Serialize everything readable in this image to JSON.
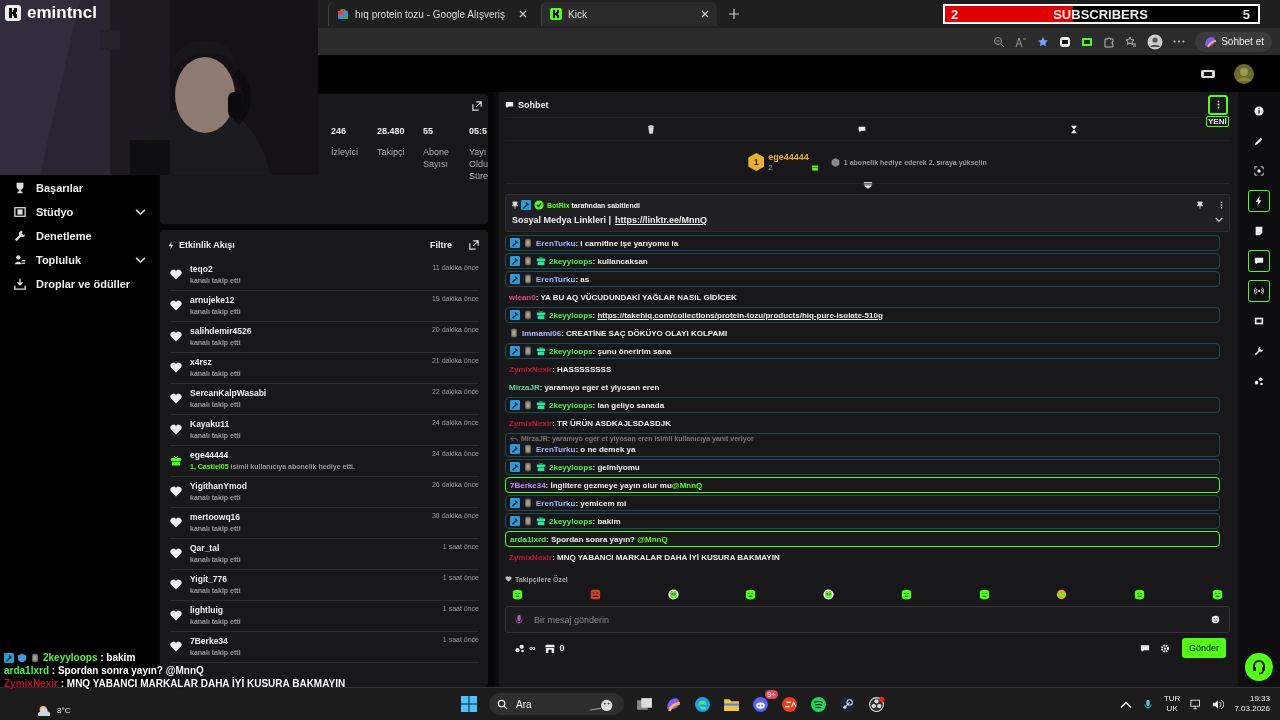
{
  "overlay": {
    "channel": "emintncl",
    "subscribers": {
      "current": "2",
      "label": "SUBSCRIBERS",
      "goal": "5",
      "level": 0.41
    },
    "chat_lines": [
      {
        "user": "2keyyloops",
        "color": "#4ff04f",
        "text": ": bakim",
        "badges": true
      },
      {
        "user": "arda1lxrd",
        "color": "#4ff04f",
        "text": ": Spordan sonra yayın? @MnnQ",
        "badges": false
      },
      {
        "user": "ZymixNexir",
        "color": "#c0143c",
        "text": ": MNQ YABANCI MARKALAR DAHA İYİ KUSURA BAKMAYIN",
        "badges": false
      }
    ]
  },
  "browser": {
    "tabs": [
      {
        "title": "hıq protein tozu - Google Alışveriş",
        "kind": "google",
        "selected": false
      },
      {
        "title": "Kick",
        "kind": "kick",
        "selected": true
      }
    ],
    "copilot_button": "Sohbet et"
  },
  "sidebar": {
    "items": [
      {
        "label": "Başarılar",
        "expandable": false
      },
      {
        "label": "Stüdyo",
        "expandable": true
      },
      {
        "label": "Denetleme",
        "expandable": false
      },
      {
        "label": "Topluluk",
        "expandable": true
      },
      {
        "label": "Droplar ve ödüller",
        "expandable": false
      }
    ]
  },
  "stats": [
    {
      "value": "246",
      "label": "İzleyici"
    },
    {
      "value": "28.480",
      "label": "Takipçi"
    },
    {
      "value": "55",
      "label": "Abone Sayısı"
    },
    {
      "value": "05:5",
      "label": "Yayı Oldu Süre"
    }
  ],
  "activity": {
    "title": "Etkinlik Akışı",
    "filter": "Filtre",
    "items": [
      {
        "kind": "follow",
        "name": "teqo2",
        "detail": "kanalı takip etti",
        "time": "11 dakika önce"
      },
      {
        "kind": "follow",
        "name": "arnujeke12",
        "detail": "kanalı takip etti",
        "time": "19 dakika önce"
      },
      {
        "kind": "follow",
        "name": "salihdemir4526",
        "detail": "kanalı takip etti",
        "time": "20 dakika önce"
      },
      {
        "kind": "follow",
        "name": "x4rsz",
        "detail": "kanalı takip etti",
        "time": "21 dakika önce"
      },
      {
        "kind": "follow",
        "name": "SercanKalpWasabi",
        "detail": "kanalı takip etti",
        "time": "22 dakika önce"
      },
      {
        "kind": "follow",
        "name": "Kayaku11",
        "detail": "kanalı takip etti",
        "time": "24 dakika önce"
      },
      {
        "kind": "gift",
        "name": "ege44444",
        "recipient": "1, Castiel05",
        "detail": "isimli kullanıcıya abonelik hediye etti.",
        "time": "24 dakika önce"
      },
      {
        "kind": "follow",
        "name": "YigithanYmod",
        "detail": "kanalı takip etti",
        "time": "26 dakika önce"
      },
      {
        "kind": "follow",
        "name": "mertoowq16",
        "detail": "kanalı takip etti",
        "time": "38 dakika önce"
      },
      {
        "kind": "follow",
        "name": "Qar_tal",
        "detail": "kanalı takip etti",
        "time": "1 saat önce"
      },
      {
        "kind": "follow",
        "name": "Yigit_776",
        "detail": "kanalı takip etti",
        "time": "1 saat önce"
      },
      {
        "kind": "follow",
        "name": "lightluig",
        "detail": "kanalı takip etti",
        "time": "1 saat önce"
      },
      {
        "kind": "follow",
        "name": "7Berke34",
        "detail": "kanalı takip etti",
        "time": "1 saat önce"
      }
    ]
  },
  "chat": {
    "title": "Sohbet",
    "new_label": "YENİ",
    "leader": {
      "rank": "1",
      "user": "ege44444",
      "count": "2",
      "hint": "1 abonelik hediye ederek 2. sıraya yükselin"
    },
    "pinned": {
      "bot": "BotRix",
      "by": "tarafından sabitlendi",
      "text": "Sosyal Medya Linkleri |",
      "link": "https://linktr.ee/MnnQ"
    },
    "messages": [
      {
        "kind": "boxed",
        "user": "ErenTurku",
        "color": "#9fb4ff",
        "moderator": true,
        "subscriber": true,
        "gifter": false,
        "text": ": I carnitine işe yarıyomu la"
      },
      {
        "kind": "boxed",
        "user": "2keyyloops",
        "color": "#4ff04f",
        "moderator": true,
        "subscriber": true,
        "gifter": true,
        "text": ": kullancaksan"
      },
      {
        "kind": "boxed",
        "user": "ErenTurku",
        "color": "#9fb4ff",
        "moderator": true,
        "subscriber": true,
        "gifter": false,
        "text": ": as"
      },
      {
        "kind": "plain",
        "user": "wlean0",
        "color": "#e0457b",
        "moderator": false,
        "subscriber": false,
        "gifter": false,
        "text": ": YA BU AQ VÜCUDUNDAKİ YAĞLAR NASIL GİDİCEK"
      },
      {
        "kind": "boxed",
        "user": "2keyyloops",
        "color": "#4ff04f",
        "moderator": true,
        "subscriber": true,
        "gifter": true,
        "text": ":",
        "link": "https://takehiq.com/collections/protein-tozu/products/hiq-pure-isolate-510g"
      },
      {
        "kind": "plain",
        "user": "Immami06",
        "color": "#b7b7ff",
        "moderator": false,
        "subscriber": true,
        "gifter": false,
        "text": ": CREATİNE SAÇ DÖKÜYO OLAYI KOLPAMI"
      },
      {
        "kind": "boxed",
        "user": "2keyyloops",
        "color": "#4ff04f",
        "moderator": true,
        "subscriber": true,
        "gifter": true,
        "text": ": şunu öneririm sana"
      },
      {
        "kind": "plain",
        "user": "ZymixNexir",
        "color": "#c0143c",
        "moderator": false,
        "subscriber": false,
        "gifter": false,
        "text": ": HASSSSSSSS"
      },
      {
        "kind": "plain",
        "user": "MirzaJR",
        "color": "#5fd6a6",
        "moderator": false,
        "subscriber": false,
        "gifter": false,
        "text": ": yaramıyo eger et yiyosan eren"
      },
      {
        "kind": "boxed",
        "user": "2keyyloops",
        "color": "#4ff04f",
        "moderator": true,
        "subscriber": true,
        "gifter": true,
        "text": ": lan geliyo sanada"
      },
      {
        "kind": "plain",
        "user": "ZymixNexir",
        "color": "#c0143c",
        "moderator": false,
        "subscriber": false,
        "gifter": false,
        "text": ": TR ÜRÜN ASDKAJLSDASDJK"
      },
      {
        "kind": "boxed",
        "reply": "MirzaJR: yaramıyo eger et yiyosan eren isimli kullanıcıya yanıt veriyor",
        "user": "ErenTurku",
        "color": "#9fb4ff",
        "moderator": true,
        "subscriber": true,
        "gifter": false,
        "text": ": o ne demek ya"
      },
      {
        "kind": "boxed",
        "user": "2keyyloops",
        "color": "#4ff04f",
        "moderator": true,
        "subscriber": true,
        "gifter": true,
        "text": ": gelmiyomu"
      },
      {
        "kind": "mention",
        "user": "7Berke34",
        "color": "#c38bff",
        "moderator": false,
        "subscriber": false,
        "gifter": false,
        "text": ": İngiltere gezmeye yayın olur mu",
        "mention": "@MnnQ"
      },
      {
        "kind": "boxed",
        "user": "ErenTurku",
        "color": "#9fb4ff",
        "moderator": true,
        "subscriber": true,
        "gifter": false,
        "text": ": yemicem mi"
      },
      {
        "kind": "boxed",
        "user": "2keyyloops",
        "color": "#4ff04f",
        "moderator": true,
        "subscriber": true,
        "gifter": true,
        "text": ": bakim"
      },
      {
        "kind": "mention",
        "user": "arda1lxrd",
        "color": "#4ff04f",
        "moderator": false,
        "subscriber": false,
        "gifter": false,
        "text": ": Spordan sonra yayın? ",
        "mention": "@MnnQ"
      },
      {
        "kind": "plain",
        "user": "ZymixNexir",
        "color": "#c0143c",
        "moderator": false,
        "subscriber": false,
        "gifter": false,
        "text": ": MNQ YABANCI MARKALAR DAHA İYİ KUSURA BAKMAYIN"
      }
    ],
    "emote_section": "Takipçilere Özel",
    "emotes": [
      {
        "kind": "blob"
      },
      {
        "kind": "angry"
      },
      {
        "kind": "alien"
      },
      {
        "kind": "blob"
      },
      {
        "kind": "alien"
      },
      {
        "kind": "blob"
      },
      {
        "kind": "blob"
      },
      {
        "kind": "face"
      },
      {
        "kind": "blob"
      },
      {
        "kind": "blob"
      }
    ],
    "input": {
      "placeholder": "Bir mesaj gönderin"
    },
    "points": "∞",
    "store_count": "0",
    "send": "Gönder"
  },
  "rail": [
    {
      "active": false
    },
    {
      "active": false
    },
    {
      "active": false
    },
    {
      "active": true
    },
    {
      "active": false
    },
    {
      "active": true
    },
    {
      "active": true
    },
    {
      "active": false
    },
    {
      "active": false
    },
    {
      "active": false
    }
  ],
  "taskbar": {
    "weather": "8°C",
    "search": "Ara",
    "discord_badge": "9+",
    "lang": "TUR",
    "layout": "UK",
    "time": "19:33",
    "date": "7.03.2026"
  }
}
